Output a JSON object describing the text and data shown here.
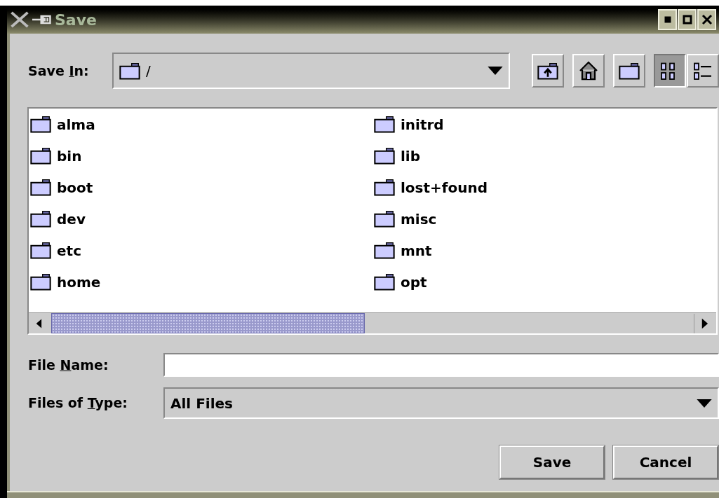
{
  "window": {
    "title": "Save"
  },
  "save_in": {
    "label": {
      "before": "Save ",
      "key": "I",
      "after": "n:"
    },
    "value": "/"
  },
  "toolbar": [
    {
      "kind": "up",
      "selected": false
    },
    {
      "kind": "home",
      "selected": false
    },
    {
      "kind": "new-folder",
      "selected": false
    },
    {
      "kind": "list",
      "selected": true
    },
    {
      "kind": "details",
      "selected": false
    }
  ],
  "files": [
    "alma",
    "bin",
    "boot",
    "dev",
    "etc",
    "home",
    "initrd",
    "lib",
    "lost+found",
    "misc",
    "mnt",
    "opt"
  ],
  "file_name": {
    "label": {
      "before": "File ",
      "key": "N",
      "after": "ame:"
    }
  },
  "file_type": {
    "label": {
      "before": "Files of ",
      "key": "T",
      "after": "ype:"
    },
    "value": "All Files"
  },
  "buttons": [
    "Save",
    "Cancel"
  ]
}
